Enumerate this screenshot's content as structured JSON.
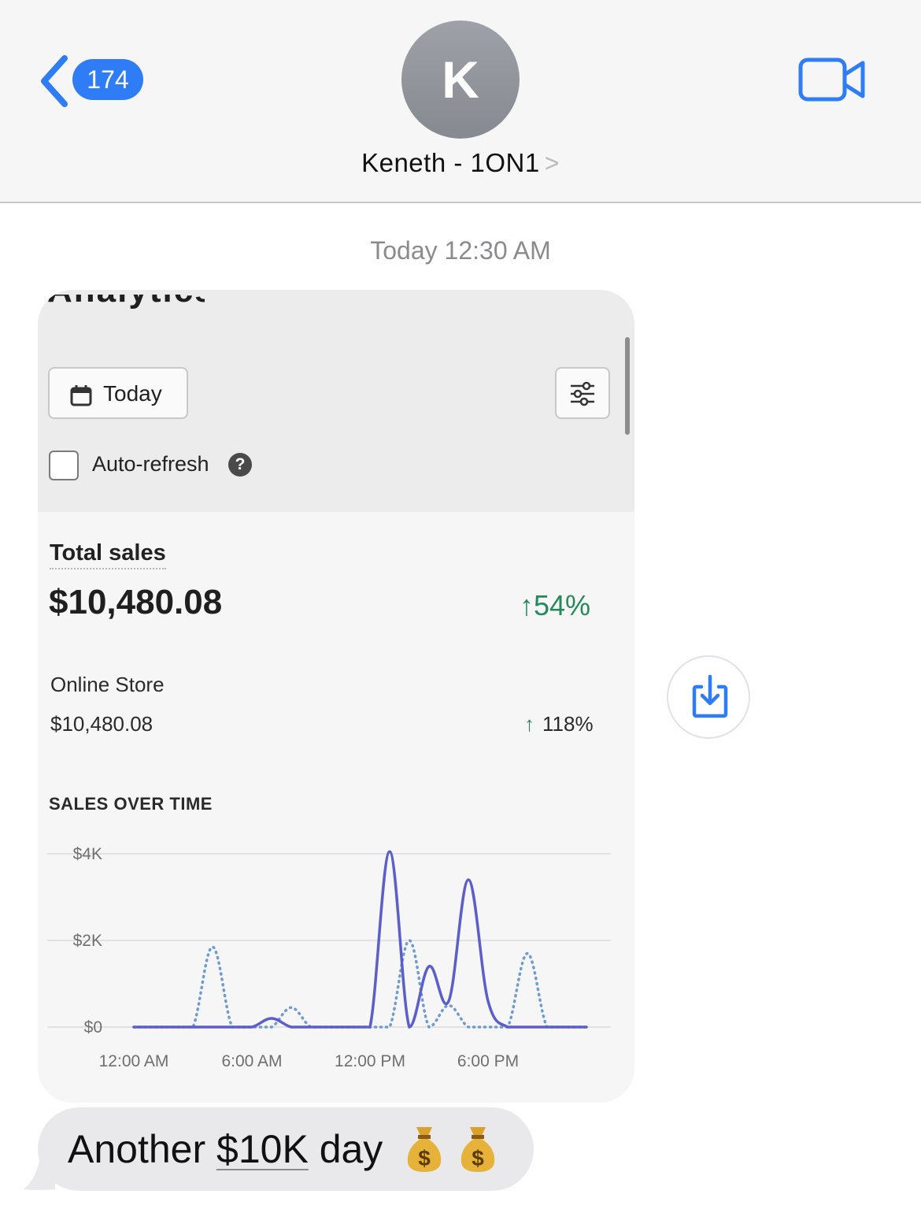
{
  "header": {
    "back_count": "174",
    "avatar_initial": "K",
    "contact_name": "Keneth - 1ON1",
    "contact_chevron": ">"
  },
  "timestamp": "Today 12:30 AM",
  "screenshot": {
    "title_cut": "Analytics",
    "date_button_label": "Today",
    "auto_refresh_label": "Auto-refresh",
    "auto_refresh_checked": false,
    "help_glyph": "?",
    "total_sales_label": "Total sales",
    "total_sales_value": "$10,480.08",
    "total_sales_change": "54%",
    "total_sales_change_arrow": "↑",
    "online_store_label": "Online Store",
    "online_store_value": "$10,480.08",
    "online_store_change": "118%",
    "online_store_change_arrow": "↑",
    "sales_over_time_label": "SALES OVER TIME",
    "accent_color": "#248a5c"
  },
  "chart_data": {
    "type": "line",
    "title": "SALES OVER TIME",
    "x_ticks": [
      "12:00 AM",
      "6:00 AM",
      "12:00 PM",
      "6:00 PM"
    ],
    "y_ticks": [
      "$4K",
      "$2K",
      "$0"
    ],
    "ylim": [
      0,
      4000
    ],
    "x_hours": [
      0,
      1,
      2,
      3,
      4,
      5,
      6,
      7,
      8,
      9,
      10,
      11,
      12,
      13,
      14,
      15,
      16,
      17,
      18,
      19,
      20,
      21,
      22,
      23
    ],
    "series": [
      {
        "style": "solid",
        "color": "#5b5fc7",
        "values": [
          0,
          0,
          0,
          0,
          0,
          0,
          0,
          200,
          0,
          0,
          0,
          0,
          0,
          4050,
          0,
          1400,
          600,
          3400,
          600,
          0,
          0,
          0,
          0,
          0
        ]
      },
      {
        "style": "dotted",
        "color": "#6e9bd1",
        "values": [
          0,
          0,
          0,
          0,
          1850,
          0,
          0,
          0,
          450,
          0,
          0,
          0,
          0,
          0,
          2000,
          0,
          500,
          0,
          0,
          0,
          1700,
          0,
          0,
          0
        ]
      }
    ]
  },
  "message": {
    "text_before": "Another ",
    "link_text": "$10K",
    "text_after": " day",
    "emoji_names": [
      "money-bag-icon",
      "money-bag-icon"
    ]
  },
  "icons": {
    "back": "chevron-left-icon",
    "video": "video-camera-icon",
    "save": "save-download-icon",
    "calendar": "calendar-icon",
    "filter": "filter-sliders-icon"
  }
}
